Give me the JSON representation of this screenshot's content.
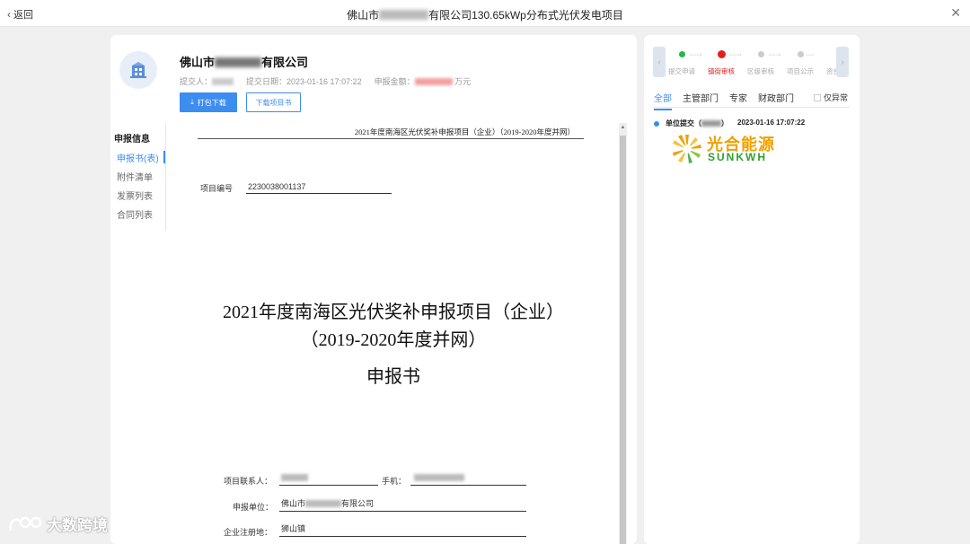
{
  "topbar": {
    "back_label": "返回",
    "title_prefix": "佛山市",
    "title_suffix": "有限公司130.65kWp分布式光伏发电项目"
  },
  "company": {
    "name_prefix": "佛山市",
    "name_suffix": "有限公司",
    "submitter_label": "提交人：",
    "submit_date": "提交日期：2023-01-16 17:07:22",
    "amount_label": "申报金额：",
    "amount_unit": "万元"
  },
  "buttons": {
    "pack_download": "打包下载",
    "download_project": "下载项目书"
  },
  "sidenav": {
    "heading": "申报信息",
    "items": [
      "申报书(表)",
      "附件清单",
      "发票列表",
      "合同列表"
    ]
  },
  "document": {
    "header": "2021年度南海区光伏奖补申报项目（企业）（2019-2020年度并网）",
    "project_no_label": "项目编号",
    "project_no": "2230038001137",
    "title_line1": "2021年度南海区光伏奖补申报项目（企业）",
    "title_line2": "（2019-2020年度并网）",
    "title_line3": "申报书",
    "contact_label": "项目联系人：",
    "phone_label": "手机：",
    "unit_label": "申报单位：",
    "unit_prefix": "佛山市",
    "unit_suffix": "有限公司",
    "reg_label": "企业注册地：",
    "reg_value": "狮山镇"
  },
  "steps": [
    {
      "label": "提交申请",
      "state": "done",
      "color": "#2bb44a"
    },
    {
      "label": "镇街审核",
      "state": "current",
      "color": "#e02020"
    },
    {
      "label": "区级审核",
      "state": "pending",
      "color": "#cccccc"
    },
    {
      "label": "项目公示",
      "state": "pending",
      "color": "#cccccc"
    },
    {
      "label": "资金",
      "state": "pending",
      "color": "#cccccc"
    }
  ],
  "tabs": [
    "全部",
    "主管部门",
    "专家",
    "财政部门"
  ],
  "only_abnormal": "仅异常",
  "timeline": {
    "event_prefix": "单位提交（",
    "event_suffix": "）",
    "date": "2023-01-16 17:07:22"
  },
  "logo": {
    "cn": "光合能源",
    "en": "SUNKWH"
  },
  "watermark": "大数跨境",
  "colors": {
    "primary": "#3c8df0",
    "current_step": "#e02020",
    "done_step": "#2bb44a"
  }
}
